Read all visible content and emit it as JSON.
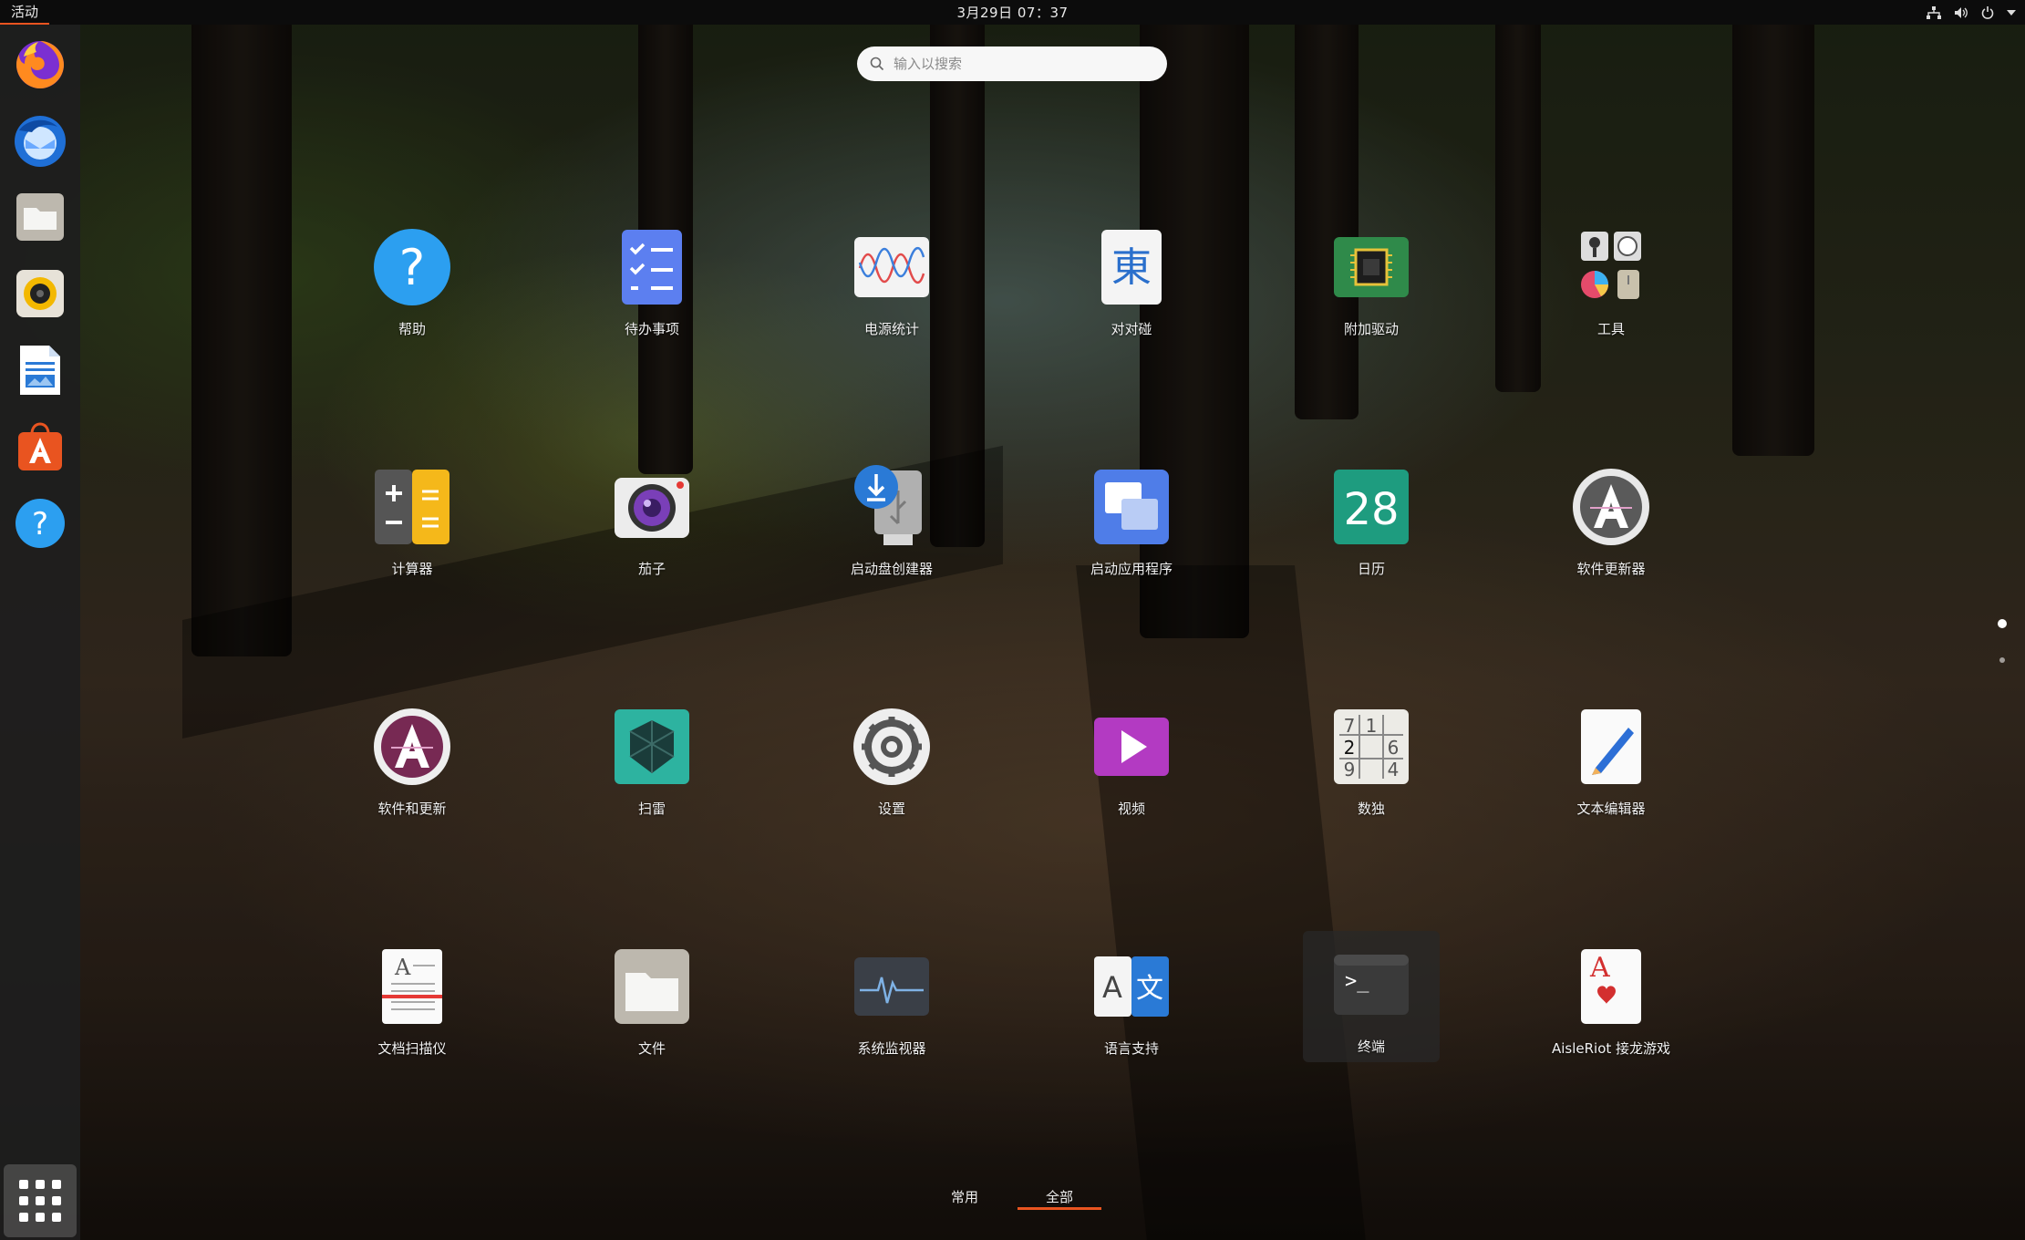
{
  "topbar": {
    "activities": "活动",
    "clock": "3月29日  07：37"
  },
  "search": {
    "placeholder": "输入以搜索"
  },
  "apps": [
    {
      "label": "帮助",
      "icon": "help-icon"
    },
    {
      "label": "待办事项",
      "icon": "todo-icon"
    },
    {
      "label": "电源统计",
      "icon": "power-stats-icon"
    },
    {
      "label": "对对碰",
      "icon": "tali-icon"
    },
    {
      "label": "附加驱动",
      "icon": "chip-icon"
    },
    {
      "label": "工具",
      "icon": "folder-tools-icon"
    },
    {
      "label": "计算器",
      "icon": "calculator-icon"
    },
    {
      "label": "茄子",
      "icon": "camera-icon"
    },
    {
      "label": "启动盘创建器",
      "icon": "usb-creator-icon"
    },
    {
      "label": "启动应用程序",
      "icon": "startup-apps-icon"
    },
    {
      "label": "日历",
      "icon": "calendar-icon"
    },
    {
      "label": "软件更新器",
      "icon": "software-updater-icon"
    },
    {
      "label": "软件和更新",
      "icon": "software-properties-icon"
    },
    {
      "label": "扫雷",
      "icon": "mines-icon"
    },
    {
      "label": "设置",
      "icon": "settings-gear-icon"
    },
    {
      "label": "视频",
      "icon": "video-play-icon"
    },
    {
      "label": "数独",
      "icon": "sudoku-icon"
    },
    {
      "label": "文本编辑器",
      "icon": "text-editor-icon"
    },
    {
      "label": "文档扫描仪",
      "icon": "scanner-icon"
    },
    {
      "label": "文件",
      "icon": "files-folder-icon"
    },
    {
      "label": "系统监视器",
      "icon": "system-monitor-icon"
    },
    {
      "label": "语言支持",
      "icon": "language-icon"
    },
    {
      "label": "终端",
      "icon": "terminal-icon"
    },
    {
      "label": "AisleRiot 接龙游戏",
      "icon": "cards-icon"
    }
  ],
  "calendar_day": "28",
  "sudoku_digits": [
    "7",
    "1",
    "",
    "2",
    "",
    "6",
    "9",
    "",
    "4"
  ],
  "tali_glyph": "東",
  "lang_glyphs": [
    "A",
    "文"
  ],
  "terminal_prompt": ">_",
  "scanner_glyph": "A",
  "cards_glyph": "A",
  "tabs": {
    "frequent": "常用",
    "all": "全部"
  },
  "colors": {
    "accent": "#e95420"
  }
}
